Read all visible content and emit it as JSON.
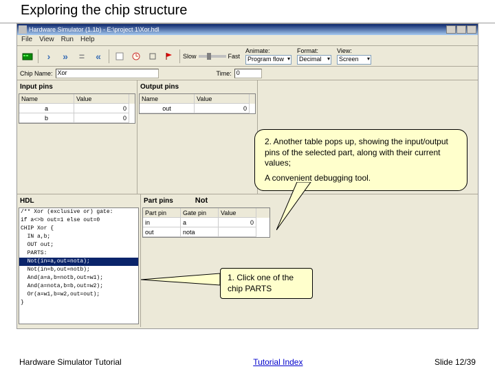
{
  "slide_title": "Exploring the chip structure",
  "window": {
    "title": "Hardware Simulator (1.1b) - E:\\project 1\\Xor.hdl"
  },
  "menu": {
    "file": "File",
    "view": "View",
    "run": "Run",
    "help": "Help"
  },
  "toolbar": {
    "slow": "Slow",
    "fast": "Fast",
    "animate_label": "Animate:",
    "animate_value": "Program flow",
    "format_label": "Format:",
    "format_value": "Decimal",
    "view_label": "View:",
    "view_value": "Screen"
  },
  "chip_row": {
    "chip_name_label": "Chip Name:",
    "chip_name_value": "Xor",
    "time_label": "Time:",
    "time_value": "0"
  },
  "panes": {
    "input_hdr": "Input pins",
    "output_hdr": "Output pins",
    "hdl_hdr": "HDL",
    "partpins_hdr": "Part pins",
    "partpins_chip": "Not"
  },
  "columns": {
    "name": "Name",
    "value": "Value",
    "partpin": "Part pin",
    "gatepin": "Gate pin"
  },
  "input_pins": [
    {
      "name": "a",
      "value": "0"
    },
    {
      "name": "b",
      "value": "0"
    }
  ],
  "output_pins": [
    {
      "name": "out",
      "value": "0"
    }
  ],
  "part_pins": [
    {
      "part": "in",
      "gate": "a",
      "value": "0"
    },
    {
      "part": "out",
      "gate": "nota",
      "value": ""
    }
  ],
  "hdl": {
    "l0": "/** Xor (exclusive or) gate:",
    "l1": "if a<>b out=1 else out=0",
    "l2": "CHIP Xor {",
    "l3": "  IN a,b;",
    "l4": "  OUT out;",
    "l5": "  PARTS:",
    "l6": "  Not(in=a,out=nota);",
    "l7": "  Not(in=b,out=notb);",
    "l8": "  And(a=a,b=notb,out=w1);",
    "l9": "  And(a=nota,b=b,out=w2);",
    "l10": "  Or(a=w1,b=w2,out=out);",
    "l11": "}"
  },
  "callouts": {
    "c2a": "2. Another table pops up, showing the input/output pins of the selected part, along with their current values;",
    "c2b": "A convenient debugging tool.",
    "c1": "1. Click one of the chip PARTS"
  },
  "footer": {
    "left": "Hardware Simulator Tutorial",
    "center": "Tutorial Index",
    "right": "Slide 12/39"
  }
}
